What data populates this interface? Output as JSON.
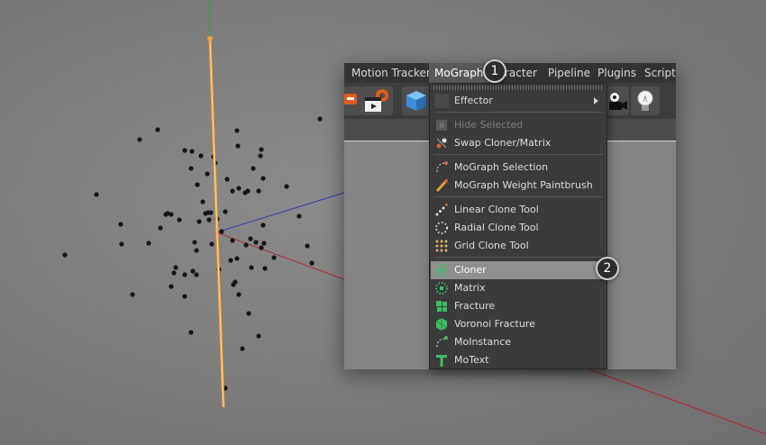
{
  "menubar": {
    "items": [
      {
        "label": "Motion Tracker"
      },
      {
        "label": "MoGraph"
      },
      {
        "label": "racter"
      },
      {
        "label": "Pipeline"
      },
      {
        "label": "Plugins"
      },
      {
        "label": "Script"
      }
    ]
  },
  "mograph_menu": {
    "items": [
      {
        "label": "Effector",
        "icon": "effector-icon",
        "submenu": true
      },
      {
        "label": "Hide Selected",
        "icon": "hide-selected-icon",
        "disabled": true
      },
      {
        "label": "Swap Cloner/Matrix",
        "icon": "swap-icon"
      },
      {
        "label": "MoGraph Selection",
        "icon": "mograph-selection-icon"
      },
      {
        "label": "MoGraph Weight Paintbrush",
        "icon": "paintbrush-icon"
      },
      {
        "label": "Linear Clone Tool",
        "icon": "linear-clone-icon"
      },
      {
        "label": "Radial Clone Tool",
        "icon": "radial-clone-icon"
      },
      {
        "label": "Grid Clone Tool",
        "icon": "grid-clone-icon"
      },
      {
        "label": "Cloner",
        "icon": "cloner-icon",
        "highlighted": true
      },
      {
        "label": "Matrix",
        "icon": "matrix-icon"
      },
      {
        "label": "Fracture",
        "icon": "fracture-icon"
      },
      {
        "label": "Voronoi Fracture",
        "icon": "voronoi-icon"
      },
      {
        "label": "MoInstance",
        "icon": "moinstance-icon"
      },
      {
        "label": "MoText",
        "icon": "motext-icon"
      }
    ]
  },
  "badges": {
    "step1": "1",
    "step2": "2"
  },
  "colors": {
    "menu_highlight": "#8f8f8f",
    "axis_y": "#e8a23a",
    "axis_x": "#c02020",
    "axis_z": "#2030c0",
    "green_icon": "#3cc060"
  }
}
